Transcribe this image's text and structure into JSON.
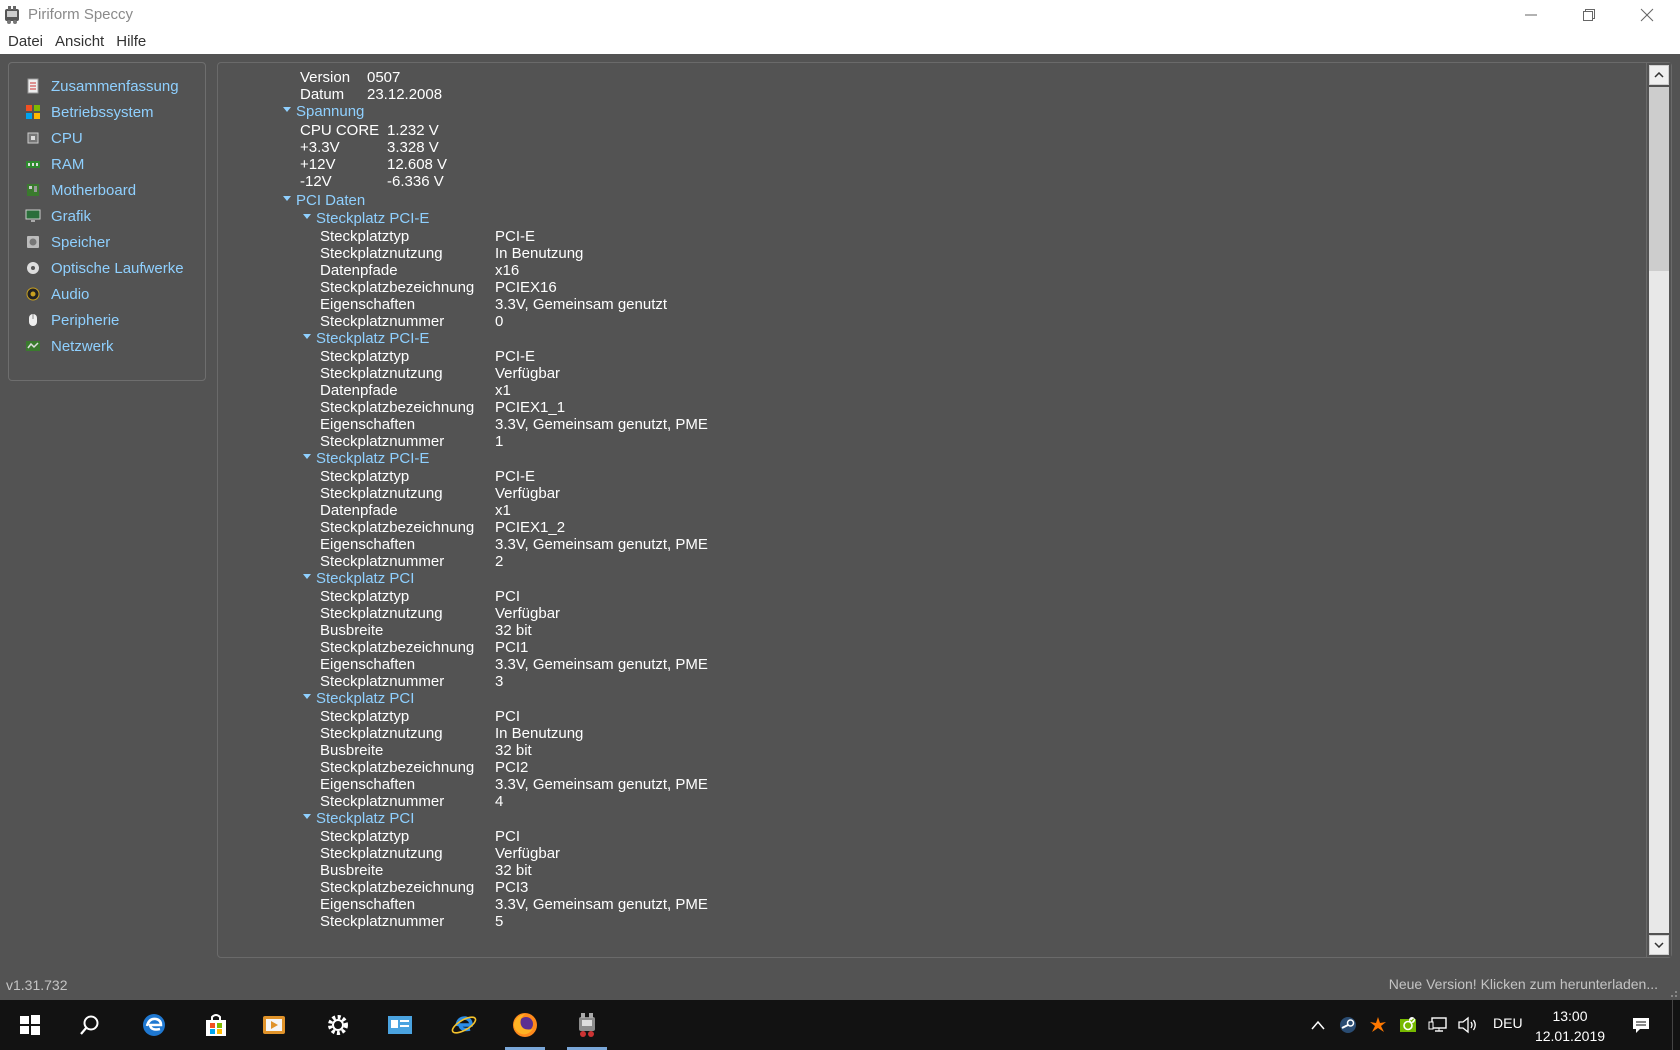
{
  "window": {
    "title": "Piriform Speccy"
  },
  "menu": [
    "Datei",
    "Ansicht",
    "Hilfe"
  ],
  "sidebar": {
    "items": [
      {
        "label": "Zusammenfassung",
        "icon": "summary-icon"
      },
      {
        "label": "Betriebssystem",
        "icon": "windows-icon"
      },
      {
        "label": "CPU",
        "icon": "cpu-icon"
      },
      {
        "label": "RAM",
        "icon": "ram-icon"
      },
      {
        "label": "Motherboard",
        "icon": "motherboard-icon"
      },
      {
        "label": "Grafik",
        "icon": "monitor-icon"
      },
      {
        "label": "Speicher",
        "icon": "harddisk-icon"
      },
      {
        "label": "Optische Laufwerke",
        "icon": "disc-icon"
      },
      {
        "label": "Audio",
        "icon": "speaker-icon"
      },
      {
        "label": "Peripherie",
        "icon": "mouse-icon"
      },
      {
        "label": "Netzwerk",
        "icon": "network-icon"
      }
    ]
  },
  "content": {
    "bios": [
      {
        "key": "Version",
        "value": "0507"
      },
      {
        "key": "Datum",
        "value": "23.12.2008"
      }
    ],
    "voltage": {
      "title": "Spannung",
      "rows": [
        {
          "key": "CPU CORE",
          "value": "1.232 V"
        },
        {
          "key": "+3.3V",
          "value": "3.328 V"
        },
        {
          "key": "+12V",
          "value": "12.608 V"
        },
        {
          "key": "-12V",
          "value": "-6.336 V"
        }
      ]
    },
    "pci": {
      "title": "PCI Daten",
      "slots": [
        {
          "title": "Steckplatz PCI-E",
          "rows": [
            {
              "key": "Steckplatztyp",
              "value": "PCI-E"
            },
            {
              "key": "Steckplatznutzung",
              "value": "In Benutzung"
            },
            {
              "key": "Datenpfade",
              "value": "x16"
            },
            {
              "key": "Steckplatzbezeichnung",
              "value": "PCIEX16"
            },
            {
              "key": "Eigenschaften",
              "value": "3.3V, Gemeinsam genutzt"
            },
            {
              "key": "Steckplatznummer",
              "value": "0"
            }
          ]
        },
        {
          "title": "Steckplatz PCI-E",
          "rows": [
            {
              "key": "Steckplatztyp",
              "value": "PCI-E"
            },
            {
              "key": "Steckplatznutzung",
              "value": "Verfügbar"
            },
            {
              "key": "Datenpfade",
              "value": "x1"
            },
            {
              "key": "Steckplatzbezeichnung",
              "value": "PCIEX1_1"
            },
            {
              "key": "Eigenschaften",
              "value": "3.3V, Gemeinsam genutzt, PME"
            },
            {
              "key": "Steckplatznummer",
              "value": "1"
            }
          ]
        },
        {
          "title": "Steckplatz PCI-E",
          "rows": [
            {
              "key": "Steckplatztyp",
              "value": "PCI-E"
            },
            {
              "key": "Steckplatznutzung",
              "value": "Verfügbar"
            },
            {
              "key": "Datenpfade",
              "value": "x1"
            },
            {
              "key": "Steckplatzbezeichnung",
              "value": "PCIEX1_2"
            },
            {
              "key": "Eigenschaften",
              "value": "3.3V, Gemeinsam genutzt, PME"
            },
            {
              "key": "Steckplatznummer",
              "value": "2"
            }
          ]
        },
        {
          "title": "Steckplatz PCI",
          "rows": [
            {
              "key": "Steckplatztyp",
              "value": "PCI"
            },
            {
              "key": "Steckplatznutzung",
              "value": "Verfügbar"
            },
            {
              "key": "Busbreite",
              "value": "32 bit"
            },
            {
              "key": "Steckplatzbezeichnung",
              "value": "PCI1"
            },
            {
              "key": "Eigenschaften",
              "value": "3.3V, Gemeinsam genutzt, PME"
            },
            {
              "key": "Steckplatznummer",
              "value": "3"
            }
          ]
        },
        {
          "title": "Steckplatz PCI",
          "rows": [
            {
              "key": "Steckplatztyp",
              "value": "PCI"
            },
            {
              "key": "Steckplatznutzung",
              "value": "In Benutzung"
            },
            {
              "key": "Busbreite",
              "value": "32 bit"
            },
            {
              "key": "Steckplatzbezeichnung",
              "value": "PCI2"
            },
            {
              "key": "Eigenschaften",
              "value": "3.3V, Gemeinsam genutzt, PME"
            },
            {
              "key": "Steckplatznummer",
              "value": "4"
            }
          ]
        },
        {
          "title": "Steckplatz PCI",
          "rows": [
            {
              "key": "Steckplatztyp",
              "value": "PCI"
            },
            {
              "key": "Steckplatznutzung",
              "value": "Verfügbar"
            },
            {
              "key": "Busbreite",
              "value": "32 bit"
            },
            {
              "key": "Steckplatzbezeichnung",
              "value": "PCI3"
            },
            {
              "key": "Eigenschaften",
              "value": "3.3V, Gemeinsam genutzt, PME"
            },
            {
              "key": "Steckplatznummer",
              "value": "5"
            }
          ]
        }
      ]
    }
  },
  "status": {
    "version": "v1.31.732",
    "update": "Neue Version! Klicken zum herunterladen..."
  },
  "taskbar": {
    "apps": [
      "start-icon",
      "search-icon",
      "edge-icon",
      "store-icon",
      "media-player-icon",
      "settings-icon",
      "id-card-icon",
      "internet-explorer-icon",
      "firefox-icon",
      "speccy-icon"
    ],
    "active_app": "speccy-icon",
    "tray": [
      "chevron-up-icon",
      "steam-icon",
      "avast-icon",
      "nvidia-icon",
      "network-icon",
      "volume-icon"
    ],
    "language": "DEU",
    "time": "13:00",
    "date": "12.01.2019"
  },
  "colors": {
    "background": "#535353",
    "accent_text": "#8fd0ff",
    "value_text": "#ffffff"
  }
}
